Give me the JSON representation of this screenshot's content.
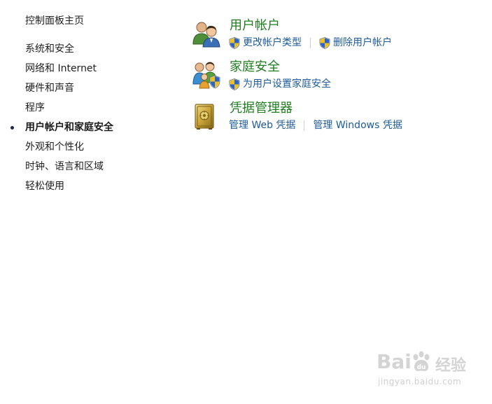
{
  "nav": {
    "home": "控制面板主页",
    "items": [
      {
        "label": "系统和安全",
        "active": false
      },
      {
        "label": "网络和 Internet",
        "active": false
      },
      {
        "label": "硬件和声音",
        "active": false
      },
      {
        "label": "程序",
        "active": false
      },
      {
        "label": "用户帐户和家庭安全",
        "active": true
      },
      {
        "label": "外观和个性化",
        "active": false
      },
      {
        "label": "时钟、语言和区域",
        "active": false
      },
      {
        "label": "轻松使用",
        "active": false
      }
    ]
  },
  "categories": [
    {
      "title": "用户帐户",
      "icon": "users-icon",
      "links": [
        {
          "label": "更改帐户类型",
          "shield": true
        },
        {
          "label": "删除用户帐户",
          "shield": true
        }
      ]
    },
    {
      "title": "家庭安全",
      "icon": "family-safety-icon",
      "links": [
        {
          "label": "为用户设置家庭安全",
          "shield": true
        }
      ]
    },
    {
      "title": "凭据管理器",
      "icon": "credential-vault-icon",
      "links": [
        {
          "label": "管理 Web 凭据",
          "shield": false
        },
        {
          "label": "管理 Windows 凭据",
          "shield": false
        }
      ]
    }
  ],
  "watermark": {
    "logo_left": "Bai",
    "logo_right": "经验",
    "url": "jingyan.baidu.com"
  },
  "colors": {
    "category_title": "#1e7d1e",
    "link": "#1d5a97",
    "nav_text": "#1e1e1e",
    "separator": "#c7cdd5"
  }
}
